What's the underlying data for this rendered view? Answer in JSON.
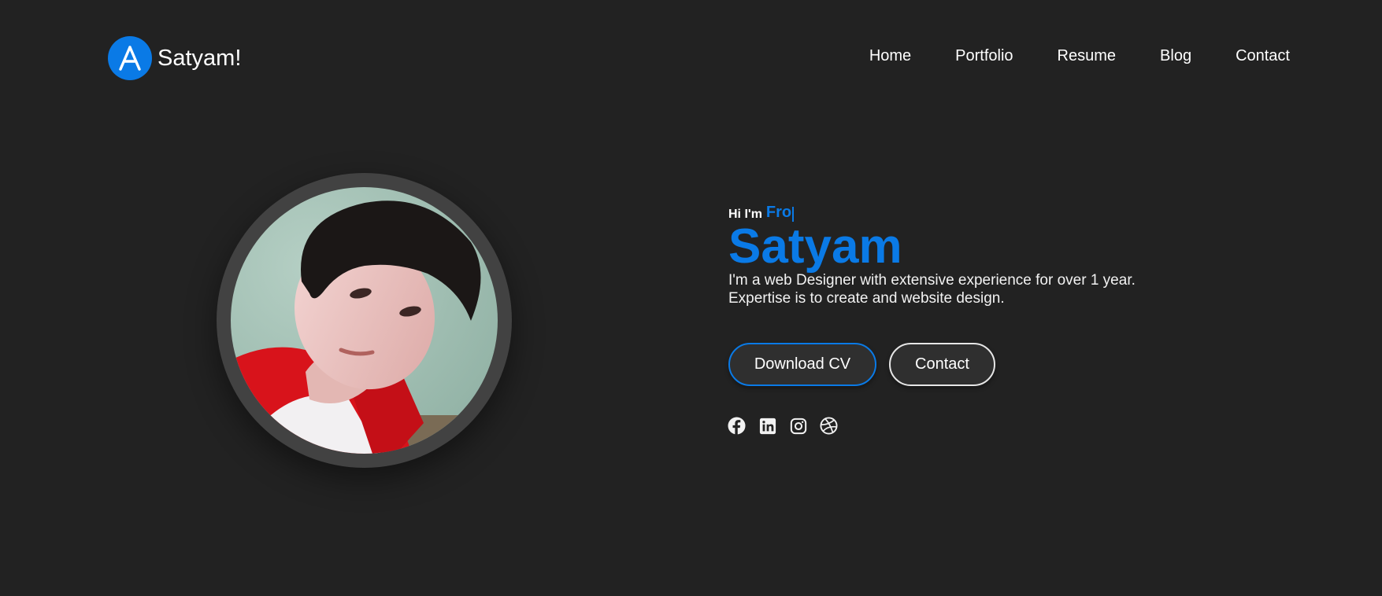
{
  "brand": {
    "logo_letter": "A",
    "name": "Satyam!"
  },
  "nav": {
    "items": [
      {
        "label": "Home"
      },
      {
        "label": "Portfolio"
      },
      {
        "label": "Resume"
      },
      {
        "label": "Blog"
      },
      {
        "label": "Contact"
      }
    ]
  },
  "hero": {
    "greeting": "Hi I'm",
    "typed_text": "Fro",
    "name": "Satyam",
    "description_line1": "I'm a web Designer with extensive experience for over 1 year.",
    "description_line2": "Expertise is to create and website design.",
    "download_cv_label": "Download CV",
    "contact_label": "Contact",
    "socials": [
      "facebook-icon",
      "linkedin-icon",
      "instagram-icon",
      "dribbble-icon"
    ]
  },
  "colors": {
    "accent": "#0a7ae6",
    "background": "#222222",
    "avatar_ring": "#424242"
  }
}
